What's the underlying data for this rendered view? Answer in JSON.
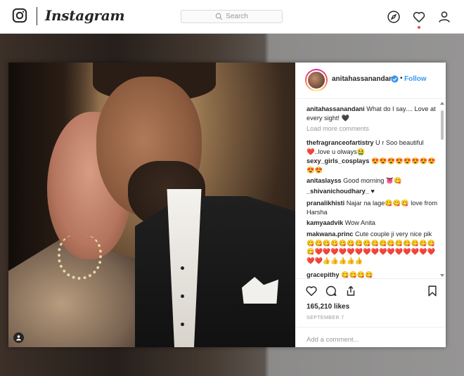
{
  "nav": {
    "brand": "Instagram",
    "search_placeholder": "Search"
  },
  "post": {
    "username": "anitahassanandani",
    "follow_label": "Follow",
    "separator": "•",
    "load_more": "Load more comments",
    "likes": "165,210 likes",
    "date": "SEPTEMBER 7",
    "add_comment_placeholder": "Add a comment...",
    "comments": [
      {
        "user": "anitahassanandani",
        "text": "What do I say.... Love at every sight! 🖤"
      },
      {
        "user": "thefragranceofartistry",
        "text": "U r Soo beautiful ❤️..love u olways🤮"
      },
      {
        "user": "sexy_girls_cosplays",
        "text": "😍😍😍😍😍😍😍😍😍😍"
      },
      {
        "user": "anitaslayss",
        "text": "Good morning 👅😋"
      },
      {
        "user": "_shivanichoudhary_",
        "text": "♥"
      },
      {
        "user": "pranalikhisti",
        "text": "Najar na lage😋😋😋 love from Harsha"
      },
      {
        "user": "kamyaadvik",
        "text": "Wow Anita"
      },
      {
        "user": "makwana.princ",
        "text": "Cute couple ji very nice pik 😋😋😋😋😋😋😋😋😋😋😋😋😋😋😋😋😋❤️❤️❤️❤️❤️❤️❤️❤️❤️❤️❤️❤️❤️❤️❤️❤️❤️👍👍👍👍👍"
      },
      {
        "user": "gracepithy",
        "text": "😋😋😋😋"
      }
    ]
  },
  "colors": {
    "link_blue": "#3897f0",
    "notification_red": "#ed4956",
    "text_dark": "#262626",
    "text_muted": "#999999"
  }
}
